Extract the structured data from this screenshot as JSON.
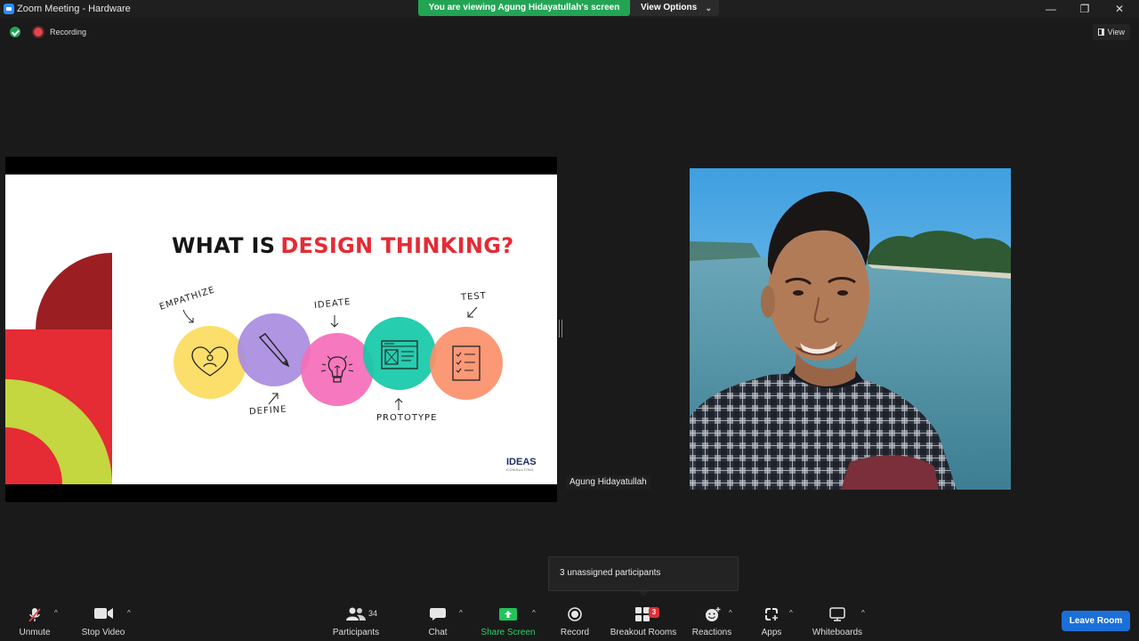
{
  "window": {
    "title": "Zoom Meeting - Hardware",
    "share_banner": "You are viewing Agung Hidayatullah's screen",
    "view_options": "View Options",
    "controls": {
      "minimize": "—",
      "restore": "❐",
      "close": "✕"
    }
  },
  "status": {
    "recording_label": "Recording",
    "view_label": "View"
  },
  "slide": {
    "title_part1": "WHAT IS",
    "title_part2": "DESIGN THINKING?",
    "stages": {
      "empathize": "EMPATHIZE",
      "define": "DEFINE",
      "ideate": "IDEATE",
      "prototype": "PROTOTYPE",
      "test": "TEST"
    },
    "logo_main": "IDEAS",
    "logo_sub": "CONSULTING"
  },
  "participant": {
    "name": "Agung Hidayatullah"
  },
  "tooltip": {
    "text": "3 unassigned participants"
  },
  "toolbar": {
    "unmute": "Unmute",
    "stop_video": "Stop Video",
    "participants": "Participants",
    "participants_count": "34",
    "chat": "Chat",
    "share_screen": "Share Screen",
    "record": "Record",
    "breakout_rooms": "Breakout Rooms",
    "breakout_badge": "3",
    "reactions": "Reactions",
    "apps": "Apps",
    "whiteboards": "Whiteboards",
    "leave": "Leave Room"
  },
  "colors": {
    "accent_green": "#23a455",
    "leave_blue": "#1b6fd8",
    "slide_red": "#e52b34",
    "empathize": "#fbdc5d",
    "define": "#a98ce0",
    "ideate": "#f56cb8",
    "prototype": "#14c9a8",
    "test": "#fb8f6a"
  }
}
